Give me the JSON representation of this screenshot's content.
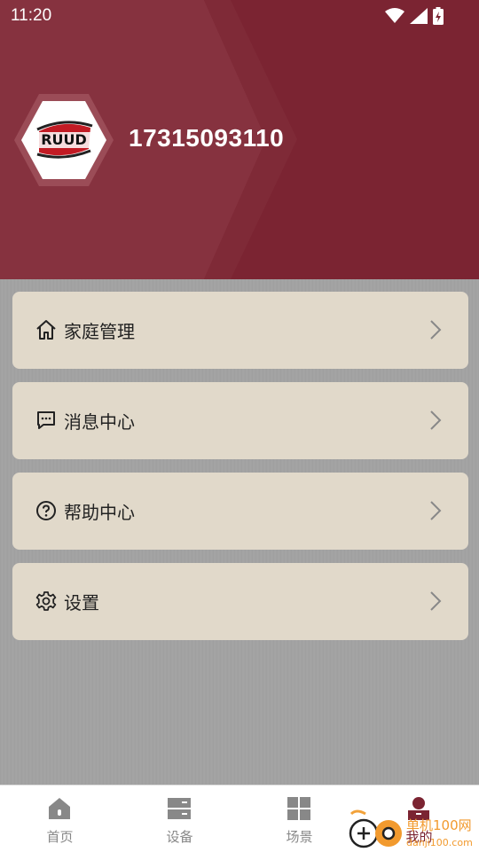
{
  "status_bar": {
    "time": "11:20"
  },
  "profile": {
    "username": "17315093110",
    "logo_text": "RUUD"
  },
  "menu": [
    {
      "label": "家庭管理",
      "icon": "home-icon"
    },
    {
      "label": "消息中心",
      "icon": "message-icon"
    },
    {
      "label": "帮助中心",
      "icon": "help-icon"
    },
    {
      "label": "设置",
      "icon": "gear-icon"
    }
  ],
  "tabs": [
    {
      "label": "首页",
      "icon": "home-tab-icon"
    },
    {
      "label": "设备",
      "icon": "device-tab-icon"
    },
    {
      "label": "场景",
      "icon": "scene-tab-icon"
    },
    {
      "label": "我的",
      "icon": "user-tab-icon",
      "active": true
    }
  ],
  "watermark": {
    "text": "单机100网",
    "subtext": "danji100.com"
  },
  "colors": {
    "brand": "#7b2432",
    "card": "#e1d9ca"
  }
}
